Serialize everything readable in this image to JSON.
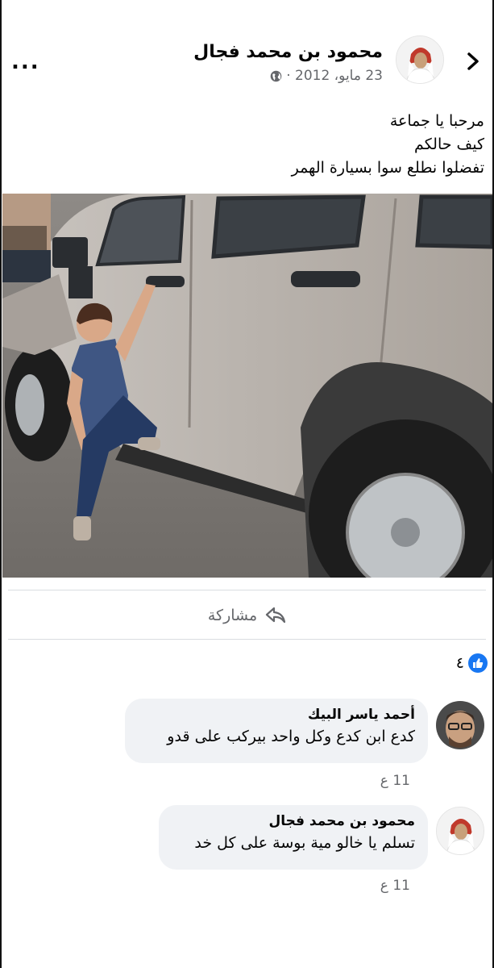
{
  "post": {
    "author": "محمود بن محمد فجال",
    "date": "23 مايو، 2012 ·",
    "more_label": "...",
    "text_lines": [
      "مرحبا يا جماعة",
      "كيف حالكم",
      "تفضلوا نطلع  سوا بسيارة الهمر"
    ],
    "photo_alt": "child standing on step of silver Hummer"
  },
  "actions": {
    "share_label": "مشاركة"
  },
  "reactions": {
    "count": "٤",
    "icon": "like-icon"
  },
  "comments": [
    {
      "name": "أحمد ياسر البيك",
      "text": "كدع ابن كدع  وكل واحد بيركب على قدو",
      "time": "11 ع"
    },
    {
      "name": "محمود بن محمد فجال",
      "text": "تسلم يا خالو مية بوسة على كل خد",
      "time": "11 ع"
    }
  ],
  "colors": {
    "accent": "#1877f2",
    "secondary_text": "#65676b",
    "bubble": "#f0f2f5"
  }
}
